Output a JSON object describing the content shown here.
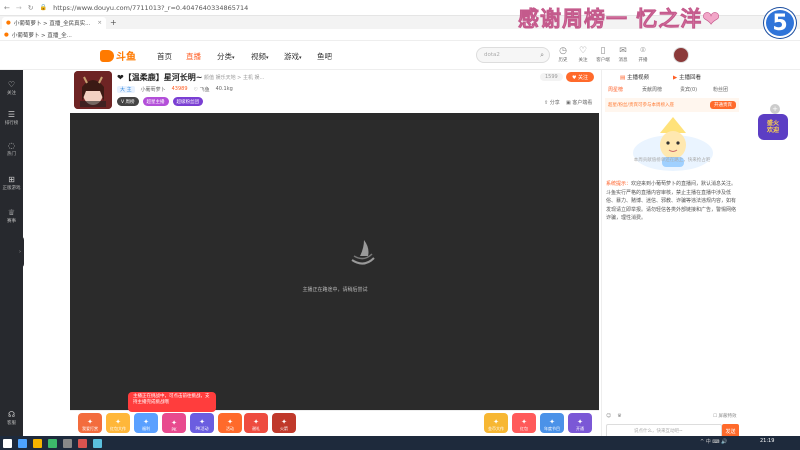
{
  "browser": {
    "url": "https://www.douyu.com/7711013?_r=0.4047640334865714",
    "tabs": [
      {
        "label": "小葡萄萝卜 > 直播_全民真实..."
      },
      {
        "label": "小葡萄萝卜 > 直播_全..."
      }
    ],
    "new_tab": "+",
    "bookmark": "小葡萄萝卜 > 直播_全..."
  },
  "overlay": {
    "thanks_text": "感谢周榜一 忆之洋❤",
    "badge": "5"
  },
  "site": {
    "logo": "斗鱼",
    "nav": [
      "首页",
      "直播",
      "分类",
      "视频",
      "游戏",
      "鱼吧"
    ],
    "search_placeholder": "dota2",
    "header_icons": [
      {
        "icon": "history-icon",
        "label": "历史"
      },
      {
        "icon": "follow-icon",
        "label": "关注"
      },
      {
        "icon": "mobile-icon",
        "label": "客户端"
      },
      {
        "icon": "bell-icon",
        "label": "消息"
      },
      {
        "icon": "location-icon",
        "label": "开播"
      }
    ]
  },
  "sidebar": {
    "items": [
      {
        "icon": "heart-icon",
        "label": "关注"
      },
      {
        "icon": "list-icon",
        "label": "排行榜"
      },
      {
        "icon": "fire-icon",
        "label": "热门"
      },
      {
        "icon": "gamepad-icon",
        "label": "正版游戏"
      },
      {
        "icon": "trophy-icon",
        "label": "赛事"
      },
      {
        "icon": "headset-icon",
        "label": "客服"
      }
    ],
    "collapse": "›"
  },
  "room": {
    "title": "❤【温柔鹿】星河长明~",
    "category": "颜值  娱乐天地 > 主机 娱...",
    "meta": [
      "大 主",
      "小葡萄萝卜",
      "43989",
      "♡ 飞鱼",
      "40.1kg"
    ],
    "badges": [
      "V 周榜",
      "超星主播",
      "超级粉丝团"
    ],
    "followers": "1599",
    "follow_label": "♥ 关注",
    "share_label": "分享",
    "client_label": "客户端看"
  },
  "player": {
    "message": "主播正在路途中，请稍后尝试"
  },
  "gifts": [
    {
      "label": "我爱打赏",
      "color": "#f36c3d"
    },
    {
      "label": "红包大作",
      "color": "#ffb73a"
    },
    {
      "label": "福利",
      "color": "#5aa0ff"
    },
    {
      "label": "PK",
      "color": "#e84a8e"
    },
    {
      "label": "PK活动",
      "color": "#6b5de0"
    },
    {
      "label": "活动",
      "color": "#ff6a2b"
    },
    {
      "label": "谢礼",
      "color": "#ee4c3f"
    },
    {
      "label": "火箭",
      "color": "#c0392b"
    },
    {
      "label": "金币大作",
      "color": "#f7b733"
    },
    {
      "label": "红包",
      "color": "#ff5a5a"
    },
    {
      "label": "年度节目",
      "color": "#4b92e8"
    },
    {
      "label": "开通",
      "color": "#7b58d6"
    }
  ],
  "promo_tip": "主播正在挑战中，可点击前往挑战，支持主播完成挑战哦",
  "right_panel": {
    "title_left": "主播视频",
    "title_right": "主播回看",
    "tabs": [
      "周星榜",
      "贡献周榜",
      "贵宾(0)",
      "粉丝团"
    ],
    "active_tab_index": 0,
    "banner_text": "超星/粉丝/贵宾可参与本周榜入座",
    "banner_button": "开通贵宾",
    "mascot_caption": "本周贡献值榜单还在路上，快来抢占吧",
    "notice_tag": "系统提示：",
    "notice_text": "欢迎来到小葡萄萝卜的直播间，默认消息关注。斗鱼实行严格的直播内容审核，禁止主播在直播中涉及低俗、暴力、赌博、迷信、邪教、诈骗等违法违规内容，如有发现请立即举报。请勿轻信各类外部链接和广告，警惕网络诈骗，理性消费。",
    "chat_placeholder": "说点什么，快来互动吧~",
    "send_label": "发送",
    "block_label": "屏蔽特效"
  },
  "float_badge": "盛火\n欢迎",
  "taskbar": {
    "time": "21:19",
    "tray": "^ 中 ⌨ 🔊"
  }
}
